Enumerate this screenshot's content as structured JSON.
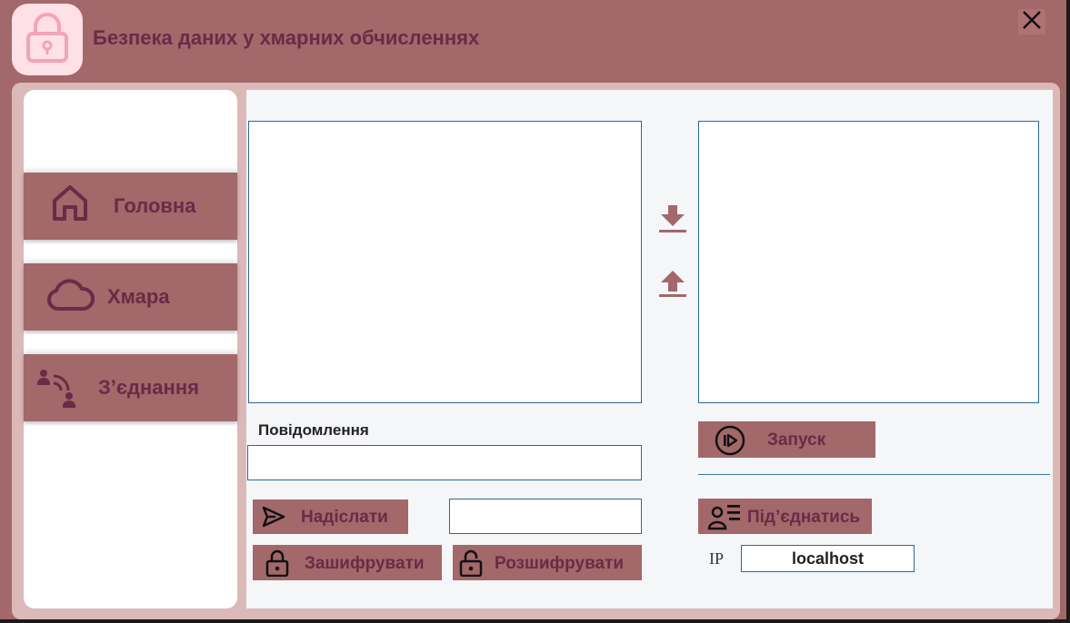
{
  "window": {
    "title": "Безпека даних у хмарних обчисленнях"
  },
  "sidebar": {
    "items": [
      {
        "label": "Головна",
        "icon": "home-icon"
      },
      {
        "label": "Хмара",
        "icon": "cloud-icon"
      },
      {
        "label": "З’єднання",
        "icon": "connection-icon"
      }
    ]
  },
  "main": {
    "left_textbox_value": "",
    "right_textbox_value": "",
    "message_label": "Повідомлення",
    "message_value": "",
    "key_value": "",
    "buttons": {
      "send": "Надіслати",
      "encrypt": "Зашифрувати",
      "decrypt": "Розшифрувати",
      "start": "Запуск",
      "connect": "Під’єднатись"
    },
    "ip_label": "IP",
    "ip_value": "localhost"
  },
  "colors": {
    "accent": "#a2686a",
    "text_dark": "#6b2a45",
    "logo_bg": "#fde1e7",
    "frame": "#dbb9b7",
    "border_blue": "#2b6a98"
  }
}
